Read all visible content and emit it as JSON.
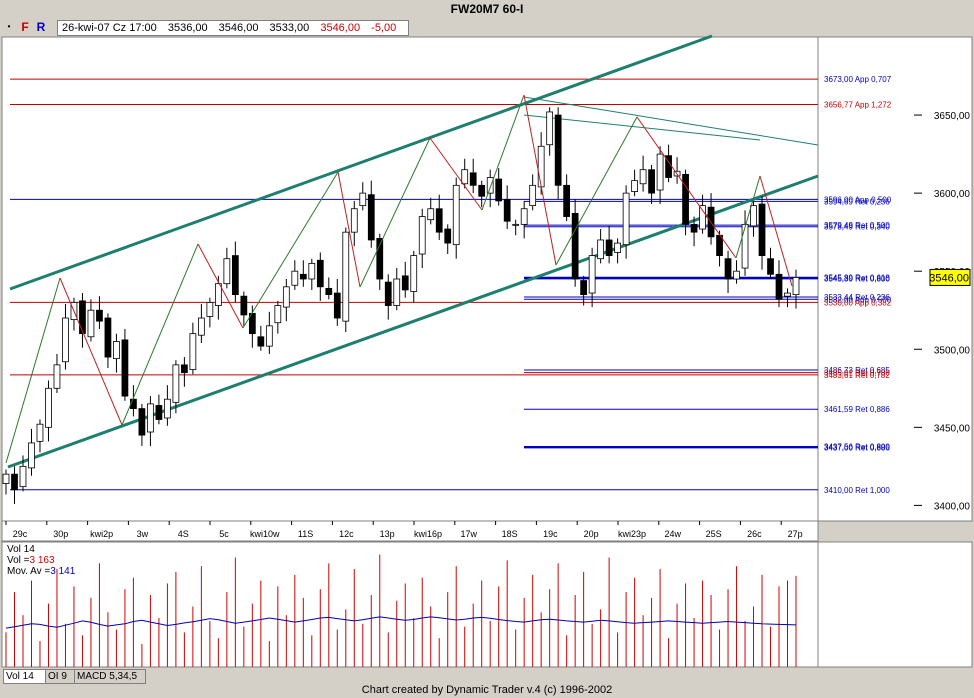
{
  "window": {
    "title": "FW20M7 60-I"
  },
  "toolbar": {
    "dot": "•",
    "f": "F",
    "r": "R"
  },
  "info": {
    "date": "26-kwi-07 Cz 17:00",
    "open": "3536,00",
    "high": "3546,00",
    "low": "3533,00",
    "close": "3546,00",
    "change": "-5,00"
  },
  "tabs": [
    "Vol 14",
    "OI 9",
    "MACD 5,34,5"
  ],
  "volume_legend": {
    "line1": "Vol 14",
    "vol_label": "Vol =",
    "vol_value": "3 163",
    "ma_label": "Mov. Av =",
    "ma_value": "3 141"
  },
  "footer": "Chart created by Dynamic Trader v.4  (c) 1996-2002",
  "colors": {
    "up": "#ffffff",
    "down": "#000000",
    "channel": "#1f7f6f",
    "swing_up": "#2a7a2a",
    "swing_down": "#c02020",
    "fib_blue": "#0000c0",
    "fib_red": "#c00000",
    "volume": "#d00000",
    "mov_avg": "#0000b0",
    "last_price_bg": "#ffff00"
  },
  "chart_data": {
    "type": "candlestick",
    "ylim": [
      3390,
      3700
    ],
    "yticks": [
      "3650,00",
      "3600,00",
      "3550,00",
      "3500,00",
      "3450,00",
      "3400,00"
    ],
    "ytick_values": [
      3650,
      3600,
      3550,
      3500,
      3450,
      3400
    ],
    "x_labels": [
      "29c",
      "30p",
      "kwi2p",
      "3w",
      "4S",
      "5c",
      "kwi10w",
      "11S",
      "12c",
      "13p",
      "kwi16p",
      "17w",
      "18S",
      "19c",
      "20p",
      "kwi23p",
      "24w",
      "25S",
      "26c",
      "27p"
    ],
    "last_price": {
      "value": 3546,
      "label": "3546,00"
    },
    "closes": [
      3420,
      3410,
      3425,
      3440,
      3452,
      3475,
      3490,
      3520,
      3530,
      3510,
      3525,
      3518,
      3495,
      3505,
      3470,
      3462,
      3445,
      3465,
      3455,
      3468,
      3490,
      3485,
      3510,
      3520,
      3530,
      3542,
      3558,
      3535,
      3522,
      3510,
      3502,
      3515,
      3528,
      3540,
      3550,
      3545,
      3555,
      3540,
      3535,
      3520,
      3575,
      3590,
      3600,
      3570,
      3545,
      3528,
      3545,
      3538,
      3560,
      3585,
      3590,
      3575,
      3568,
      3605,
      3615,
      3605,
      3598,
      3610,
      3595,
      3582,
      3580,
      3590,
      3605,
      3630,
      3652,
      3605,
      3585,
      3545,
      3535,
      3560,
      3570,
      3560,
      3568,
      3600,
      3608,
      3615,
      3600,
      3625,
      3610,
      3614,
      3580,
      3575,
      3592,
      3572,
      3560,
      3545,
      3550,
      3580,
      3592,
      3560,
      3548,
      3532,
      3536,
      3546
    ],
    "fib_levels": [
      {
        "value": 3673.0,
        "label": "3673,00 App 0,707",
        "color": "red_text",
        "span": "full"
      },
      {
        "value": 3656.77,
        "label": "3656,77 App 1,272",
        "color": "red",
        "span": "full"
      },
      {
        "value": 3596.0,
        "label": "3596,00 App 0,500",
        "color": "blue",
        "span": "full"
      },
      {
        "value": 3594.69,
        "label": "3594,69 Ret 0,236",
        "color": "blue",
        "span": "right"
      },
      {
        "value": 3579.49,
        "label": "3579,49 Ret 0,500",
        "color": "blue",
        "span": "right"
      },
      {
        "value": 3578.49,
        "label": "3578,49 Ret 0,340",
        "color": "blue",
        "span": "right"
      },
      {
        "value": 3545.89,
        "label": "3545,89 Ret 0,618",
        "color": "blue",
        "span": "right"
      },
      {
        "value": 3545.3,
        "label": "3545,30 Ret 0,800",
        "color": "blue",
        "span": "right"
      },
      {
        "value": 3533.44,
        "label": "3533,44 Ret 0,236",
        "color": "blue",
        "span": "right"
      },
      {
        "value": 3532.0,
        "label": "3532,00 App 0,500",
        "color": "blue",
        "span": "right"
      },
      {
        "value": 3530.0,
        "label": "3530,00 App 0,382",
        "color": "red",
        "span": "full"
      },
      {
        "value": 3486.73,
        "label": "3486,73 Ret 0,685",
        "color": "blue",
        "span": "right"
      },
      {
        "value": 3485.01,
        "label": "3485,01 Ret 0,786",
        "color": "red",
        "span": "right"
      },
      {
        "value": 3483.61,
        "label": "3483,61 Ret 0,782",
        "color": "red",
        "span": "full"
      },
      {
        "value": 3461.59,
        "label": "3461,59 Ret 0,886",
        "color": "blue",
        "span": "right"
      },
      {
        "value": 3437.56,
        "label": "3437,56 Ret 0,800",
        "color": "blue",
        "span": "right"
      },
      {
        "value": 3437.0,
        "label": "3437,00 Ret 0,886",
        "color": "blue",
        "span": "right"
      },
      {
        "value": 3410.0,
        "label": "3410,00 Ret 1,000",
        "color": "blue",
        "span": "full"
      }
    ],
    "volume": {
      "ylim": [
        0,
        4200
      ],
      "values": [
        1200,
        2600,
        1800,
        3000,
        900,
        2200,
        3400,
        1500,
        2800,
        1100,
        2400,
        3600,
        1900,
        1300,
        2700,
        3100,
        800,
        2500,
        1700,
        2900,
        3300,
        1200,
        2100,
        3500,
        1600,
        1000,
        2600,
        3800,
        1400,
        2200,
        3000,
        900,
        2800,
        1800,
        3200,
        2400,
        1100,
        2700,
        3600,
        1300,
        2000,
        3400,
        1500,
        2500,
        3900,
        1200,
        2300,
        2900,
        1700,
        3100,
        2100,
        1000,
        2600,
        3500,
        1400,
        2200,
        3000,
        1600,
        2800,
        3700,
        1300,
        2400,
        3200,
        1900,
        2700,
        3600,
        1100,
        2500,
        3300,
        1500,
        2000,
        3800,
        1200,
        2600,
        3100,
        1800,
        2400,
        3400,
        1000,
        2200,
        2900,
        1700,
        3000,
        2500,
        1300,
        2700,
        3500,
        1600,
        2100,
        3200,
        1400,
        2800,
        3000,
        3163
      ],
      "ma": [
        1350,
        1400,
        1450,
        1500,
        1480,
        1420,
        1380,
        1450,
        1520,
        1600,
        1550,
        1480,
        1420,
        1460,
        1500,
        1580,
        1620,
        1560,
        1500,
        1440,
        1480,
        1530,
        1570,
        1620,
        1680,
        1640,
        1580,
        1520,
        1560,
        1600,
        1650,
        1700,
        1660,
        1610,
        1560,
        1600,
        1650,
        1700,
        1720,
        1680,
        1640,
        1600,
        1640,
        1690,
        1740,
        1700,
        1660,
        1620,
        1650,
        1700,
        1740,
        1710,
        1670,
        1630,
        1660,
        1700,
        1720,
        1690,
        1650,
        1610,
        1580,
        1560,
        1600,
        1640,
        1660,
        1630,
        1600,
        1580,
        1560,
        1590,
        1620,
        1600,
        1570,
        1540,
        1520,
        1540,
        1560,
        1580,
        1600,
        1580,
        1560,
        1540,
        1520,
        1540,
        1560,
        1580,
        1560,
        1540,
        1520,
        1500,
        1490,
        1480,
        1470,
        1460
      ]
    }
  }
}
